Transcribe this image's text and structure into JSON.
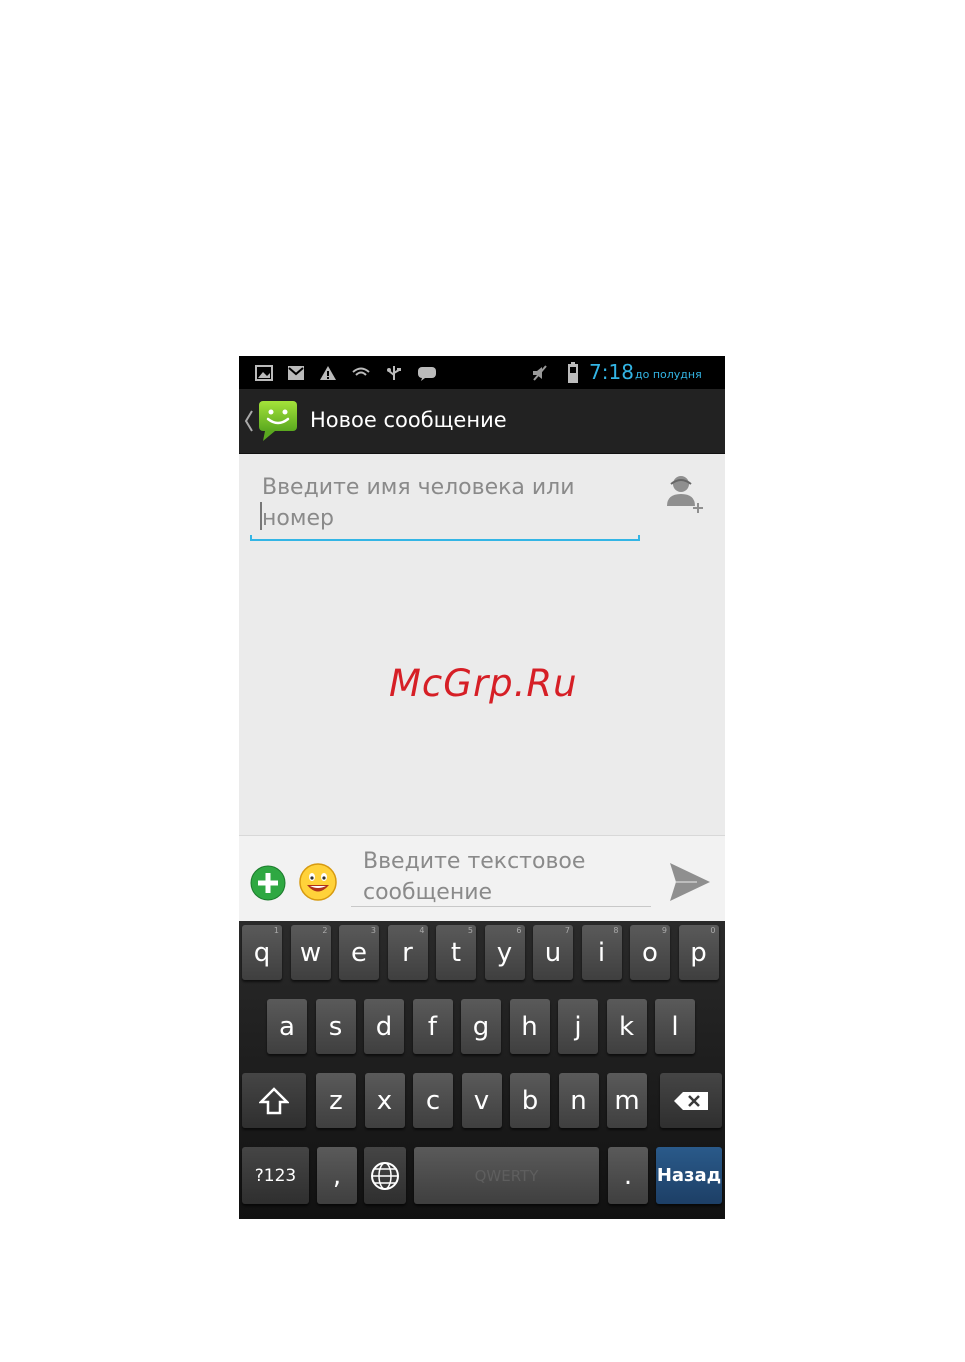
{
  "status_bar": {
    "time": "7:18",
    "ampm": "до полудня",
    "time_color": "#33b5e5"
  },
  "action_bar": {
    "title": "Новое сообщение"
  },
  "recipient": {
    "placeholder": "Введите имя человека или номер"
  },
  "watermark": "McGrp.Ru",
  "compose": {
    "placeholder": "Введите текстовое сообщение"
  },
  "keyboard": {
    "row1": [
      {
        "label": "q",
        "hint": "1"
      },
      {
        "label": "w",
        "hint": "2"
      },
      {
        "label": "e",
        "hint": "3"
      },
      {
        "label": "r",
        "hint": "4"
      },
      {
        "label": "t",
        "hint": "5"
      },
      {
        "label": "y",
        "hint": "6"
      },
      {
        "label": "u",
        "hint": "7"
      },
      {
        "label": "i",
        "hint": "8"
      },
      {
        "label": "o",
        "hint": "9"
      },
      {
        "label": "p",
        "hint": "0"
      }
    ],
    "row2": [
      "a",
      "s",
      "d",
      "f",
      "g",
      "h",
      "j",
      "k",
      "l"
    ],
    "row3": [
      "z",
      "x",
      "c",
      "v",
      "b",
      "n",
      "m"
    ],
    "symbols_label": "?123",
    "comma_label": ",",
    "space_label": "QWERTY",
    "period_label": ".",
    "enter_label": "Назад"
  },
  "colors": {
    "accent": "#33b5e5",
    "watermark": "#d61f26",
    "enter_key": "#1d3f66"
  }
}
